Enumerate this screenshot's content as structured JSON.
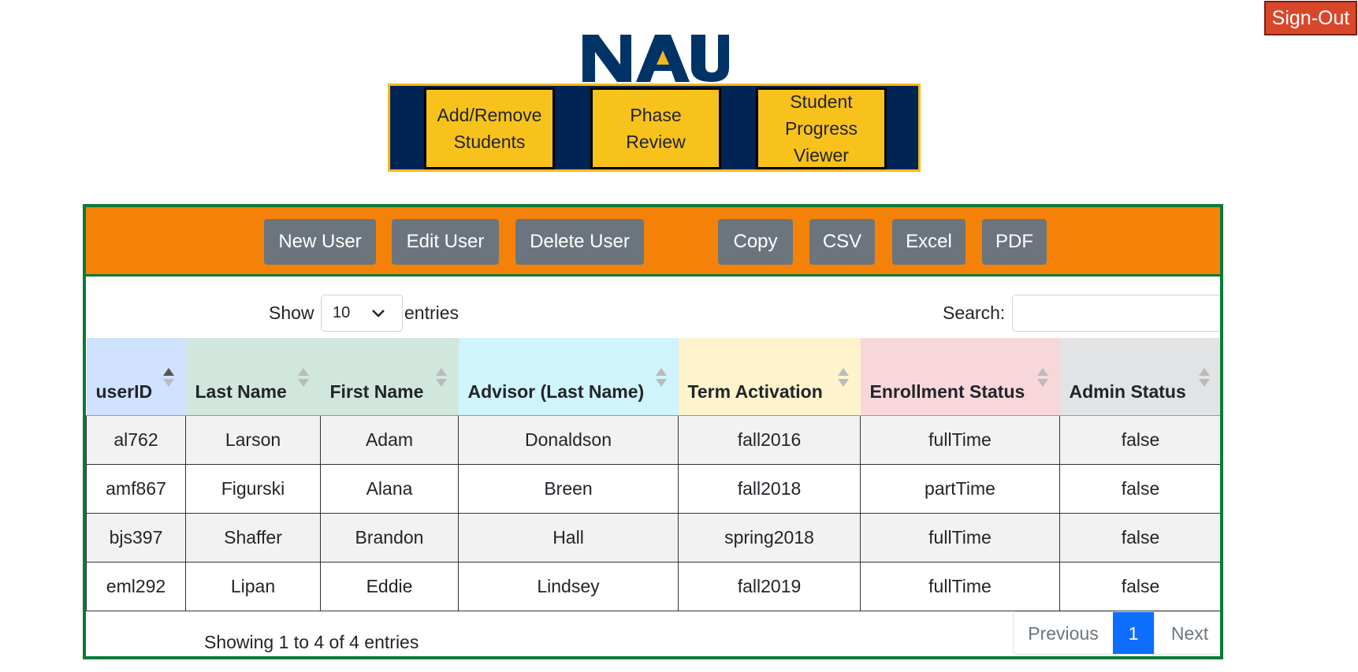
{
  "header": {
    "signout_label": "Sign-Out",
    "logo_text": "NAU",
    "nav": [
      "Add/Remove Students",
      "Phase Review",
      "Student Progress Viewer"
    ]
  },
  "toolbar": {
    "new_user": "New User",
    "edit_user": "Edit User",
    "delete_user": "Delete User",
    "copy": "Copy",
    "csv": "CSV",
    "excel": "Excel",
    "pdf": "PDF"
  },
  "controls": {
    "show_label": "Show",
    "page_length": "10",
    "entries_label": "entries",
    "search_label": "Search:"
  },
  "table": {
    "columns": [
      {
        "label": "userID",
        "color": "#cfe2ff",
        "sorted": "asc"
      },
      {
        "label": "Last Name",
        "color": "#d1e7dd",
        "sorted": "none"
      },
      {
        "label": "First Name",
        "color": "#d1e7dd",
        "sorted": "none"
      },
      {
        "label": "Advisor (Last Name)",
        "color": "#cff4fc",
        "sorted": "none"
      },
      {
        "label": "Term Activation",
        "color": "#fff3cd",
        "sorted": "none"
      },
      {
        "label": "Enrollment Status",
        "color": "#f8d7da",
        "sorted": "none"
      },
      {
        "label": "Admin Status",
        "color": "#e2e3e5",
        "sorted": "none"
      }
    ],
    "rows": [
      [
        "al762",
        "Larson",
        "Adam",
        "Donaldson",
        "fall2016",
        "fullTime",
        "false"
      ],
      [
        "amf867",
        "Figurski",
        "Alana",
        "Breen",
        "fall2018",
        "partTime",
        "false"
      ],
      [
        "bjs397",
        "Shaffer",
        "Brandon",
        "Hall",
        "spring2018",
        "fullTime",
        "false"
      ],
      [
        "eml292",
        "Lipan",
        "Eddie",
        "Lindsey",
        "fall2019",
        "fullTime",
        "false"
      ]
    ]
  },
  "footer": {
    "info": "Showing 1 to 4 of 4 entries",
    "previous": "Previous",
    "current_page": "1",
    "next": "Next"
  },
  "colors": {
    "toolbar_bg": "#f58208",
    "panel_border": "#0b7a36",
    "nav_bg": "#002454",
    "nav_button": "#f8c21c",
    "signout_bg": "#d9472b",
    "button_gray": "#6c757d",
    "active_page": "#0d6efd"
  }
}
